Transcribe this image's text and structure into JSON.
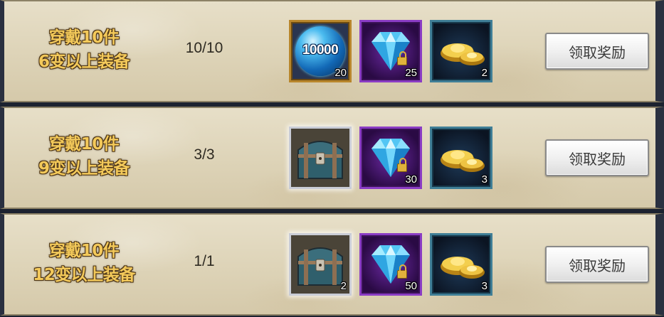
{
  "rows": [
    {
      "condition_line1": "穿戴10件",
      "condition_line2": "6变以上装备",
      "progress": "10/10",
      "rewards": [
        {
          "icon": "energy-orb-icon",
          "label": "10000",
          "count": "20"
        },
        {
          "icon": "blue-diamond-locked-icon",
          "count": "25"
        },
        {
          "icon": "gold-ingot-icon",
          "count": "2"
        }
      ],
      "button_label": "领取奖励"
    },
    {
      "condition_line1": "穿戴10件",
      "condition_line2": "9变以上装备",
      "progress": "3/3",
      "rewards": [
        {
          "icon": "treasure-chest-icon",
          "count": ""
        },
        {
          "icon": "blue-diamond-locked-icon",
          "count": "30"
        },
        {
          "icon": "gold-ingot-icon",
          "count": "3"
        }
      ],
      "button_label": "领取奖励"
    },
    {
      "condition_line1": "穿戴10件",
      "condition_line2": "12变以上装备",
      "progress": "1/1",
      "rewards": [
        {
          "icon": "treasure-chest-icon",
          "count": "2"
        },
        {
          "icon": "blue-diamond-locked-icon",
          "count": "50"
        },
        {
          "icon": "gold-ingot-icon",
          "count": "3"
        }
      ],
      "button_label": "领取奖励"
    }
  ],
  "colors": {
    "condition_text": "#f3c95a",
    "panel_bg": "#e7dfc8",
    "frame_purple": "#8a3cc4",
    "frame_teal": "#3f7e96",
    "frame_gold": "#b8862c"
  }
}
